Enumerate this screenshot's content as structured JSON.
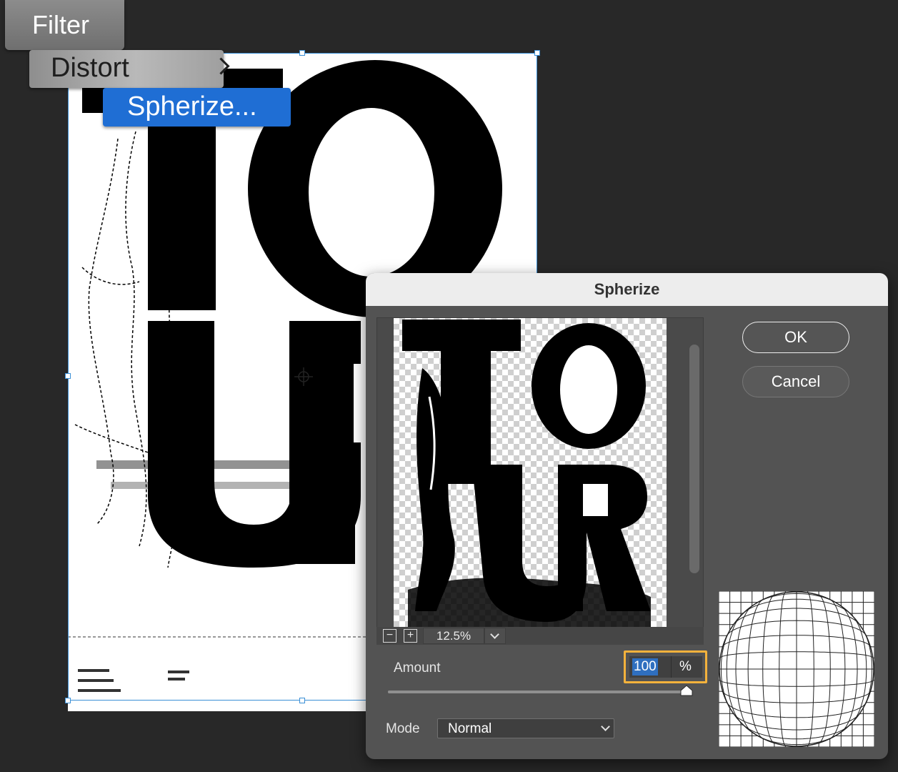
{
  "menu": {
    "filter_label": "Filter",
    "distort_label": "Distort",
    "spherize_label": "Spherize..."
  },
  "dialog": {
    "title": "Spherize",
    "ok_label": "OK",
    "cancel_label": "Cancel",
    "zoom_value": "12.5%",
    "zoom_out_symbol": "−",
    "zoom_in_symbol": "+",
    "amount_label": "Amount",
    "amount_value": "100",
    "amount_unit": "%",
    "amount_fraction": 1.0,
    "mode_label": "Mode",
    "mode_value": "Normal"
  },
  "preview": {
    "letters": [
      "T",
      "O",
      "U",
      "R"
    ]
  },
  "colors": {
    "menu_highlight": "#1f6ed4",
    "focus_outline": "#f4b23c",
    "selection_frame": "#3a8fd6"
  }
}
